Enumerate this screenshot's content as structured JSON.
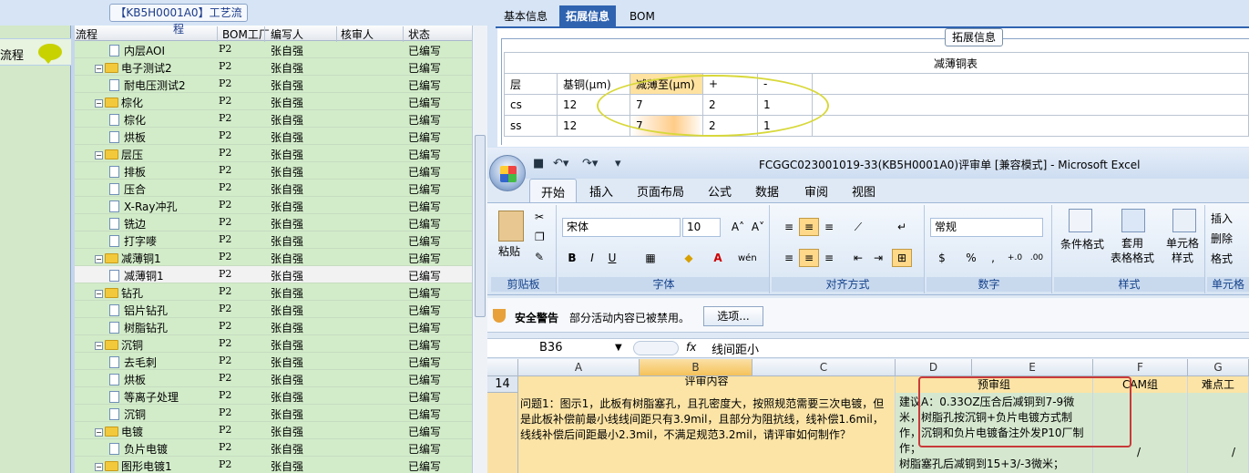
{
  "left_nav": {
    "label": "流程"
  },
  "tree": {
    "title": "【KB5H0001A0】工艺流程",
    "columns": [
      "流程",
      "BOM工厂",
      "编写人",
      "核审人",
      "状态"
    ],
    "rows": [
      {
        "indent": 2,
        "type": "doc",
        "name": "内层AOI",
        "bom": "P2",
        "editor": "张自强",
        "status": "已编写"
      },
      {
        "indent": 1,
        "type": "folder",
        "name": "电子测试2",
        "bom": "P2",
        "editor": "张自强",
        "status": "已编写"
      },
      {
        "indent": 2,
        "type": "doc",
        "name": "耐电压测试2",
        "bom": "P2",
        "editor": "张自强",
        "status": "已编写"
      },
      {
        "indent": 1,
        "type": "folder",
        "name": "棕化",
        "bom": "P2",
        "editor": "张自强",
        "status": "已编写"
      },
      {
        "indent": 2,
        "type": "doc",
        "name": "棕化",
        "bom": "P2",
        "editor": "张自强",
        "status": "已编写"
      },
      {
        "indent": 2,
        "type": "doc",
        "name": "烘板",
        "bom": "P2",
        "editor": "张自强",
        "status": "已编写"
      },
      {
        "indent": 1,
        "type": "folder",
        "name": "层压",
        "bom": "P2",
        "editor": "张自强",
        "status": "已编写"
      },
      {
        "indent": 2,
        "type": "doc",
        "name": "排板",
        "bom": "P2",
        "editor": "张自强",
        "status": "已编写"
      },
      {
        "indent": 2,
        "type": "doc",
        "name": "压合",
        "bom": "P2",
        "editor": "张自强",
        "status": "已编写"
      },
      {
        "indent": 2,
        "type": "doc",
        "name": "X-Ray冲孔",
        "bom": "P2",
        "editor": "张自强",
        "status": "已编写"
      },
      {
        "indent": 2,
        "type": "doc",
        "name": "铣边",
        "bom": "P2",
        "editor": "张自强",
        "status": "已编写"
      },
      {
        "indent": 2,
        "type": "doc",
        "name": "打字嘜",
        "bom": "P2",
        "editor": "张自强",
        "status": "已编写"
      },
      {
        "indent": 1,
        "type": "folder",
        "name": "减薄铜1",
        "bom": "P2",
        "editor": "张自强",
        "status": "已编写"
      },
      {
        "indent": 2,
        "type": "doc",
        "name": "减薄铜1",
        "bom": "P2",
        "editor": "张自强",
        "status": "已编写",
        "selected": true
      },
      {
        "indent": 1,
        "type": "folder",
        "name": "钻孔",
        "bom": "P2",
        "editor": "张自强",
        "status": "已编写"
      },
      {
        "indent": 2,
        "type": "doc",
        "name": "铝片钻孔",
        "bom": "P2",
        "editor": "张自强",
        "status": "已编写"
      },
      {
        "indent": 2,
        "type": "doc",
        "name": "树脂钻孔",
        "bom": "P2",
        "editor": "张自强",
        "status": "已编写"
      },
      {
        "indent": 1,
        "type": "folder",
        "name": "沉铜",
        "bom": "P2",
        "editor": "张自强",
        "status": "已编写"
      },
      {
        "indent": 2,
        "type": "doc",
        "name": "去毛刺",
        "bom": "P2",
        "editor": "张自强",
        "status": "已编写"
      },
      {
        "indent": 2,
        "type": "doc",
        "name": "烘板",
        "bom": "P2",
        "editor": "张自强",
        "status": "已编写"
      },
      {
        "indent": 2,
        "type": "doc",
        "name": "等离子处理",
        "bom": "P2",
        "editor": "张自强",
        "status": "已编写"
      },
      {
        "indent": 2,
        "type": "doc",
        "name": "沉铜",
        "bom": "P2",
        "editor": "张自强",
        "status": "已编写"
      },
      {
        "indent": 1,
        "type": "folder",
        "name": "电镀",
        "bom": "P2",
        "editor": "张自强",
        "status": "已编写"
      },
      {
        "indent": 2,
        "type": "doc",
        "name": "负片电镀",
        "bom": "P2",
        "editor": "张自强",
        "status": "已编写"
      },
      {
        "indent": 1,
        "type": "folder",
        "name": "图形电镀1",
        "bom": "P2",
        "editor": "张自强",
        "status": "已编写"
      }
    ]
  },
  "right_tabs": [
    "基本信息",
    "拓展信息",
    "BOM"
  ],
  "ext_info": {
    "label": "拓展信息",
    "table_title": "减薄铜表",
    "headers": [
      "层",
      "基铜(μm)",
      "减薄至(μm)",
      "+",
      "-"
    ],
    "rows": [
      [
        "cs",
        "12",
        "7",
        "2",
        "1"
      ],
      [
        "ss",
        "12",
        "7",
        "2",
        "1"
      ]
    ]
  },
  "excel": {
    "title": "FCGGC023001019-33(KB5H0001A0)评审单  [兼容模式]  - Microsoft Excel",
    "tabs": [
      "开始",
      "插入",
      "页面布局",
      "公式",
      "数据",
      "审阅",
      "视图"
    ],
    "font_name": "宋体",
    "font_size": "10",
    "number_format": "常规",
    "groups": [
      "剪贴板",
      "字体",
      "对齐方式",
      "数字",
      "样式",
      "单元格"
    ],
    "paste_label": "粘贴",
    "cond_format": "条件格式",
    "table_format": "套用\n表格格式",
    "cell_style": "单元格\n样式",
    "insert_label": "插入",
    "delete_label": "删除",
    "format_label": "格式",
    "security_warning": "安全警告",
    "security_message": "部分活动内容已被禁用。",
    "options_button": "选项...",
    "name_box": "B36",
    "fx": "fx",
    "formula": "线间距小",
    "columns": [
      "A",
      "B",
      "C",
      "D",
      "E",
      "F",
      "G"
    ],
    "row_number": "14",
    "header_row": {
      "b": "评审内容",
      "de": "预审组",
      "f": "CAM组",
      "g": "难点工"
    },
    "question": "问题1：图示1，此板有树脂塞孔，且孔密度大，按照规范需要三次电镀，但是此板补偿前最小线线间距只有3.9mil，且部分为阻抗线，线补偿1.6mil，线线补偿后间距最小2.3mil，不满足规范3.2mil，请评审如何制作？",
    "suggestion": "建议A：0.33OZ压合后减铜到7-9微米，树脂孔按沉铜+负片电镀方式制作，沉铜和负片电镀备注外发P10厂制作；\n树脂塞孔后减铜到15+3/-3微米；",
    "slash": "/"
  }
}
